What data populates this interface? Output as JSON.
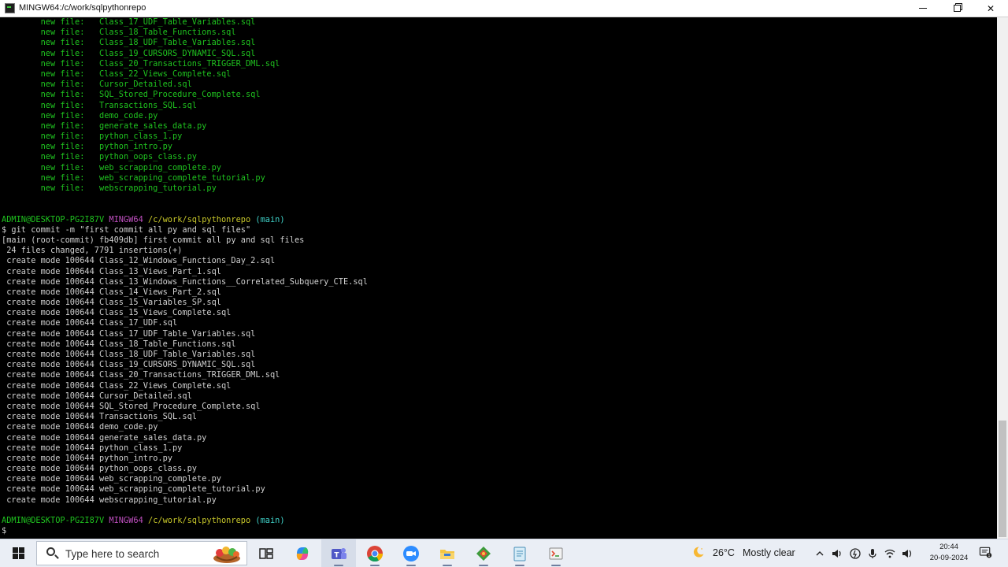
{
  "window": {
    "title": "MINGW64:/c/work/sqlpythonrepo",
    "minimize": "minimize",
    "maximize": "maximize",
    "close": "✕"
  },
  "terminal": {
    "staged_label": "new file:",
    "staged_files": [
      "Class_17_UDF_Table_Variables.sql",
      "Class_18_Table_Functions.sql",
      "Class_18_UDF_Table_Variables.sql",
      "Class_19_CURSORS_DYNAMIC_SQL.sql",
      "Class_20_Transactions_TRIGGER_DML.sql",
      "Class_22_Views_Complete.sql",
      "Cursor_Detailed.sql",
      "SQL_Stored_Procedure_Complete.sql",
      "Transactions_SQL.sql",
      "demo_code.py",
      "generate_sales_data.py",
      "python_class_1.py",
      "python_intro.py",
      "python_oops_class.py",
      "web_scrapping_complete.py",
      "web_scrapping_complete_tutorial.py",
      "webscrapping_tutorial.py"
    ],
    "prompt": {
      "user": "ADMIN@DESKTOP-PG2I87V",
      "env": "MINGW64",
      "path": "/c/work/sqlpythonrepo",
      "branch": "(main)",
      "symbol": "$"
    },
    "command": "git commit -m \"first commit all py and sql files\"",
    "result_line": "[main (root-commit) fb409db] first commit all py and sql files",
    "summary_line": " 24 files changed, 7791 insertions(+)",
    "create_prefix": " create mode 100644",
    "created_files": [
      "Class_12_Windows_Functions_Day_2.sql",
      "Class_13_Views_Part_1.sql",
      "Class_13_Windows_Functions__Correlated_Subquery_CTE.sql",
      "Class_14_Views_Part_2.sql",
      "Class_15_Variables_SP.sql",
      "Class_15_Views_Complete.sql",
      "Class_17_UDF.sql",
      "Class_17_UDF_Table_Variables.sql",
      "Class_18_Table_Functions.sql",
      "Class_18_UDF_Table_Variables.sql",
      "Class_19_CURSORS_DYNAMIC_SQL.sql",
      "Class_20_Transactions_TRIGGER_DML.sql",
      "Class_22_Views_Complete.sql",
      "Cursor_Detailed.sql",
      "SQL_Stored_Procedure_Complete.sql",
      "Transactions_SQL.sql",
      "demo_code.py",
      "generate_sales_data.py",
      "python_class_1.py",
      "python_intro.py",
      "python_oops_class.py",
      "web_scrapping_complete.py",
      "web_scrapping_complete_tutorial.py",
      "webscrapping_tutorial.py"
    ],
    "final_prompt_symbol": "$"
  },
  "taskbar": {
    "search_placeholder": "Type here to search",
    "apps": [
      {
        "name": "task-view",
        "active": false
      },
      {
        "name": "copilot",
        "active": false
      },
      {
        "name": "teams",
        "active": true
      },
      {
        "name": "chrome",
        "active": false
      },
      {
        "name": "zoom",
        "active": false
      },
      {
        "name": "file-explorer",
        "active": false
      },
      {
        "name": "git-gui",
        "active": false
      },
      {
        "name": "notepad",
        "active": false
      },
      {
        "name": "git-bash",
        "active": false
      }
    ],
    "weather": {
      "temp": "26°C",
      "desc": "Mostly clear"
    },
    "clock": {
      "time": "20:44",
      "date": "20-09-2024"
    }
  },
  "colors": {
    "git_green": "#1fc21f",
    "prompt_green": "#1fc21f",
    "prompt_magenta": "#c150c1",
    "prompt_yellow": "#c7c72a",
    "prompt_cyan": "#3fd1c8",
    "taskbar": "#eaeef5"
  }
}
